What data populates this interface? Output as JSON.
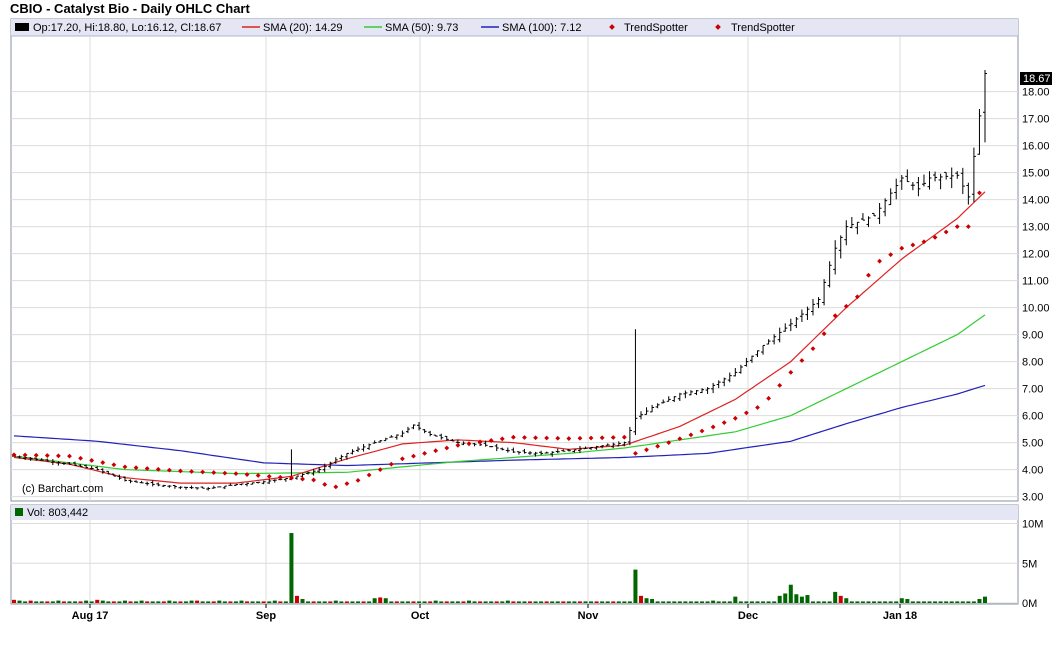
{
  "chart_data": {
    "type": "ohlc",
    "title": "CBIO - Catalyst Bio - Daily OHLC Chart",
    "legend": {
      "ohlc": "Op:17.20, Hi:18.80, Lo:16.12, Cl:18.67",
      "sma20": "SMA (20): 14.29",
      "sma50": "SMA (50): 9.73",
      "sma100": "SMA (100): 7.12",
      "trend1": "TrendSpotter",
      "trend2": "TrendSpotter"
    },
    "copyright": "(c) Barchart.com",
    "last_price_label": "18.67",
    "price_ticks": [
      "18.00",
      "17.00",
      "16.00",
      "15.00",
      "14.00",
      "13.00",
      "12.00",
      "11.00",
      "10.00",
      "9.00",
      "8.00",
      "7.00",
      "6.00",
      "5.00",
      "4.00",
      "3.00"
    ],
    "x_ticks": [
      "Aug 17",
      "Sep",
      "Oct",
      "Nov",
      "Dec",
      "Jan 18"
    ],
    "volume_label": "Vol: 803,442",
    "volume_ticks": [
      "10M",
      "5M",
      "0M"
    ],
    "colors": {
      "sma20": "#dd2222",
      "sma50": "#33cc33",
      "sma100": "#2222bb",
      "trend": "#cc0000",
      "vol_up": "#006600",
      "vol_down": "#cc0000",
      "grid": "#d8d8d8",
      "header_bg": "#e4e6f4"
    },
    "ohlc_anchors": [
      [
        0,
        4.5
      ],
      [
        5,
        4.35
      ],
      [
        10,
        4.2
      ],
      [
        15,
        4.0
      ],
      [
        20,
        3.6
      ],
      [
        25,
        3.45
      ],
      [
        30,
        3.35
      ],
      [
        35,
        3.3
      ],
      [
        40,
        3.45
      ],
      [
        45,
        3.55
      ],
      [
        50,
        3.7
      ],
      [
        55,
        4.0
      ],
      [
        60,
        4.6
      ],
      [
        65,
        5.0
      ],
      [
        70,
        5.35
      ],
      [
        72,
        5.65
      ],
      [
        75,
        5.3
      ],
      [
        80,
        5.0
      ],
      [
        85,
        4.9
      ],
      [
        90,
        4.65
      ],
      [
        95,
        4.6
      ],
      [
        100,
        4.7
      ],
      [
        105,
        4.85
      ],
      [
        110,
        5.0
      ],
      [
        112,
        5.9
      ],
      [
        115,
        6.3
      ],
      [
        120,
        6.8
      ],
      [
        125,
        7.0
      ],
      [
        130,
        7.6
      ],
      [
        135,
        8.6
      ],
      [
        140,
        9.4
      ],
      [
        145,
        10.3
      ],
      [
        148,
        12.2
      ],
      [
        150,
        13.0
      ],
      [
        155,
        13.4
      ],
      [
        160,
        14.8
      ],
      [
        163,
        14.4
      ],
      [
        165,
        14.8
      ],
      [
        170,
        14.9
      ],
      [
        172,
        14.1
      ],
      [
        174,
        17.1
      ],
      [
        175,
        18.67
      ]
    ],
    "sma20_anchors": [
      [
        0,
        4.45
      ],
      [
        10,
        4.2
      ],
      [
        20,
        3.7
      ],
      [
        30,
        3.5
      ],
      [
        40,
        3.5
      ],
      [
        50,
        3.75
      ],
      [
        60,
        4.4
      ],
      [
        70,
        4.95
      ],
      [
        80,
        5.1
      ],
      [
        90,
        5.0
      ],
      [
        100,
        4.75
      ],
      [
        110,
        4.9
      ],
      [
        120,
        5.6
      ],
      [
        130,
        6.6
      ],
      [
        140,
        8.0
      ],
      [
        150,
        10.0
      ],
      [
        160,
        11.8
      ],
      [
        170,
        13.3
      ],
      [
        175,
        14.29
      ]
    ],
    "sma50_anchors": [
      [
        0,
        4.5
      ],
      [
        20,
        4.0
      ],
      [
        40,
        3.85
      ],
      [
        60,
        3.9
      ],
      [
        80,
        4.3
      ],
      [
        100,
        4.6
      ],
      [
        110,
        4.8
      ],
      [
        120,
        5.1
      ],
      [
        130,
        5.4
      ],
      [
        140,
        6.0
      ],
      [
        150,
        7.0
      ],
      [
        160,
        8.0
      ],
      [
        170,
        9.0
      ],
      [
        175,
        9.73
      ]
    ],
    "sma100_anchors": [
      [
        0,
        5.25
      ],
      [
        15,
        5.05
      ],
      [
        30,
        4.7
      ],
      [
        45,
        4.25
      ],
      [
        60,
        4.15
      ],
      [
        75,
        4.25
      ],
      [
        90,
        4.35
      ],
      [
        110,
        4.45
      ],
      [
        125,
        4.6
      ],
      [
        140,
        5.05
      ],
      [
        150,
        5.7
      ],
      [
        160,
        6.3
      ],
      [
        170,
        6.8
      ],
      [
        175,
        7.12
      ]
    ],
    "trend_anchors": [
      [
        0,
        4.55
      ],
      [
        10,
        4.5
      ],
      [
        20,
        4.1
      ],
      [
        30,
        3.95
      ],
      [
        40,
        3.85
      ],
      [
        55,
        3.6
      ],
      [
        57,
        3.3
      ],
      [
        62,
        3.6
      ],
      [
        70,
        4.4
      ],
      [
        80,
        4.9
      ],
      [
        90,
        5.2
      ],
      [
        100,
        5.15
      ],
      [
        110,
        5.2
      ],
      [
        112,
        4.6
      ],
      [
        118,
        5.0
      ],
      [
        125,
        5.5
      ],
      [
        130,
        5.9
      ],
      [
        135,
        6.4
      ],
      [
        140,
        7.6
      ],
      [
        145,
        8.7
      ],
      [
        148,
        9.7
      ],
      [
        152,
        10.4
      ],
      [
        155,
        11.6
      ],
      [
        160,
        12.2
      ],
      [
        165,
        12.5
      ],
      [
        170,
        13.0
      ],
      [
        172,
        13.0
      ],
      [
        173,
        13.9
      ],
      [
        175,
        14.6
      ]
    ],
    "volume_m": [
      0.4,
      0.3,
      0.2,
      0.3,
      0.2,
      0.2,
      0.2,
      0.2,
      0.3,
      0.2,
      0.2,
      0.2,
      0.2,
      0.3,
      0.2,
      0.4,
      0.3,
      0.2,
      0.2,
      0.2,
      0.3,
      0.2,
      0.2,
      0.3,
      0.2,
      0.2,
      0.2,
      0.2,
      0.3,
      0.2,
      0.2,
      0.2,
      0.3,
      0.3,
      0.2,
      0.2,
      0.2,
      0.3,
      0.2,
      0.2,
      0.2,
      0.3,
      0.2,
      0.2,
      0.2,
      0.2,
      0.2,
      0.3,
      0.2,
      0.2,
      0.2,
      0.2,
      0.2,
      0.2,
      0.2,
      0.2,
      0.2,
      0.2,
      0.3,
      0.2,
      0.2,
      0.2,
      0.2,
      0.2,
      0.2,
      0.2,
      0.3,
      0.2,
      0.2,
      0.2,
      0.2,
      0.2,
      0.2,
      0.2,
      0.2,
      0.2,
      0.3,
      0.2,
      0.2,
      0.2,
      0.2,
      0.2,
      0.3,
      0.2,
      0.2,
      0.2,
      0.2,
      0.2,
      0.2,
      0.3,
      0.2,
      0.2,
      0.2,
      0.2,
      0.2,
      0.2,
      0.2,
      0.2,
      0.2,
      0.2,
      0.2,
      0.2,
      0.2,
      0.2,
      0.2,
      0.2,
      0.2,
      0.2,
      0.2,
      0.2,
      0.2,
      0.2,
      0.3,
      0.2,
      0.2,
      0.2,
      0.2,
      0.2,
      0.2,
      0.2,
      0.2,
      0.2,
      0.2,
      0.2,
      0.2,
      0.2,
      0.3,
      0.2,
      0.2,
      0.2,
      0.2,
      0.2,
      0.2,
      0.2,
      0.2,
      0.2,
      0.2,
      0.2,
      0.2,
      0.2,
      0.2,
      0.2,
      0.2,
      0.2,
      0.2,
      0.2,
      0.2,
      0.2,
      0.2,
      0.2,
      0.2,
      0.2,
      0.2,
      0.2,
      0.2,
      0.2,
      0.2,
      0.2,
      0.2,
      0.2,
      0.2,
      0.2,
      0.2,
      0.2,
      0.2,
      0.2,
      0.2,
      0.2,
      0.2,
      0.2,
      0.2,
      0.2,
      0.2,
      0.2,
      0.2,
      0.2,
      0.2,
      0.2
    ],
    "volume_spikes": [
      [
        50,
        8.8
      ],
      [
        51,
        0.9
      ],
      [
        52,
        0.5
      ],
      [
        65,
        0.6
      ],
      [
        66,
        0.7
      ],
      [
        67,
        0.6
      ],
      [
        112,
        4.2
      ],
      [
        113,
        0.9
      ],
      [
        114,
        0.6
      ],
      [
        115,
        0.5
      ],
      [
        130,
        0.8
      ],
      [
        138,
        0.9
      ],
      [
        139,
        1.2
      ],
      [
        140,
        2.3
      ],
      [
        141,
        1.1
      ],
      [
        142,
        0.8
      ],
      [
        143,
        1.0
      ],
      [
        148,
        1.4
      ],
      [
        149,
        0.9
      ],
      [
        150,
        0.6
      ],
      [
        160,
        0.6
      ],
      [
        161,
        0.5
      ],
      [
        174,
        0.5
      ],
      [
        175,
        0.8
      ]
    ]
  }
}
